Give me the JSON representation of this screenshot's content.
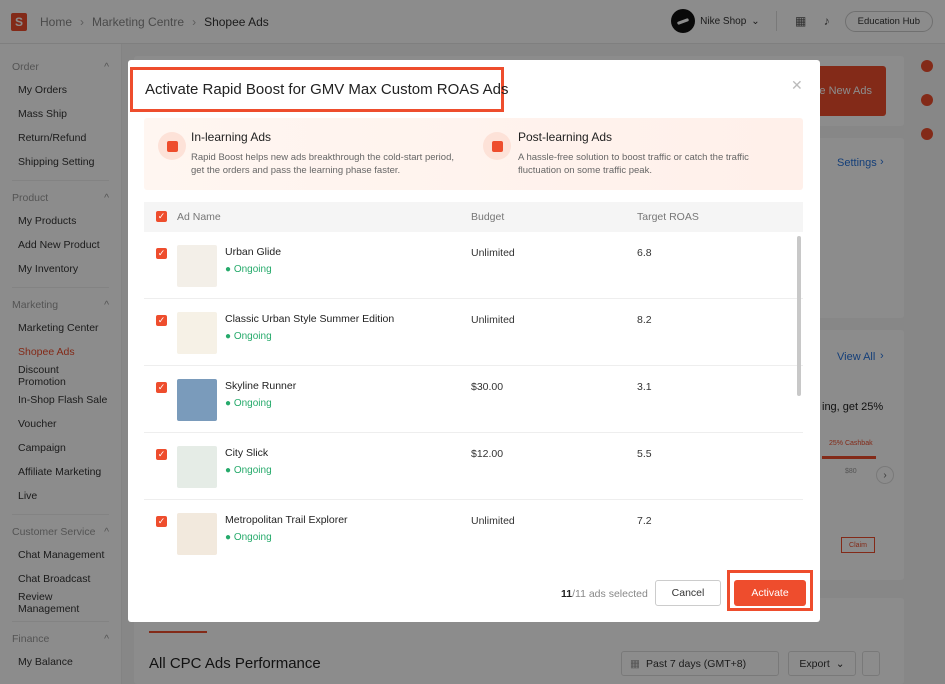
{
  "topbar": {
    "logo_text": "S",
    "breadcrumbs": [
      "Home",
      "Marketing Centre",
      "Shopee Ads"
    ],
    "shop_name": "Nike Shop",
    "education_hub": "Education Hub"
  },
  "sidebar": {
    "sections": [
      {
        "title": "Order",
        "items": [
          "My Orders",
          "Mass Ship",
          "Return/Refund",
          "Shipping Setting"
        ]
      },
      {
        "title": "Product",
        "items": [
          "My Products",
          "Add New Product",
          "My Inventory"
        ]
      },
      {
        "title": "Marketing",
        "items": [
          "Marketing Center",
          "Shopee Ads",
          "Discount Promotion",
          "In-Shop Flash Sale",
          "Voucher",
          "Campaign",
          "Affiliate Marketing",
          "Live"
        ]
      },
      {
        "title": "Customer Service",
        "items": [
          "Chat Management",
          "Chat Broadcast",
          "Review Management"
        ]
      },
      {
        "title": "Finance",
        "items": [
          "My Balance"
        ]
      }
    ],
    "active_item": "Shopee Ads"
  },
  "background": {
    "create_ads": "ate New Ads",
    "settings": "Settings",
    "view_all": "View All",
    "promo_text": "ing, get 25%",
    "cashback": "25% Cashbak",
    "cashback_value": "$80",
    "claim": "Claim",
    "perf_title": "All CPC Ads Performance",
    "date_range": "Past 7 days (GMT+8)",
    "export": "Export"
  },
  "modal": {
    "title": "Activate Rapid Boost for GMV Max Custom ROAS Ads",
    "in_learning_title": "In-learning Ads",
    "in_learning_desc_1": "Rapid Boost helps new ads breakthrough the cold-start period,",
    "in_learning_desc_2": "get the orders and pass the learning phase faster.",
    "post_learning_title": "Post-learning Ads",
    "post_learning_desc_1": "A hassle-free solution to boost traffic or catch the traffic",
    "post_learning_desc_2": "fluctuation on some traffic peak.",
    "columns": {
      "name": "Ad Name",
      "budget": "Budget",
      "roas": "Target ROAS"
    },
    "ads": [
      {
        "name": "Urban Glide",
        "status": "Ongoing",
        "budget": "Unlimited",
        "roas": "6.8"
      },
      {
        "name": "Classic Urban Style Summer Edition",
        "status": "Ongoing",
        "budget": "Unlimited",
        "roas": "8.2"
      },
      {
        "name": "Skyline Runner",
        "status": "Ongoing",
        "budget": "$30.00",
        "roas": "3.1"
      },
      {
        "name": "City Slick",
        "status": "Ongoing",
        "budget": "$12.00",
        "roas": "5.5"
      },
      {
        "name": "Metropolitan Trail Explorer",
        "status": "Ongoing",
        "budget": "Unlimited",
        "roas": "7.2"
      }
    ],
    "selected_count": "11",
    "selected_suffix": "/11 ads selected",
    "cancel": "Cancel",
    "activate": "Activate"
  },
  "colors": {
    "accent": "#ee4d2d",
    "success": "#26aa6b",
    "link": "#2673dd"
  }
}
